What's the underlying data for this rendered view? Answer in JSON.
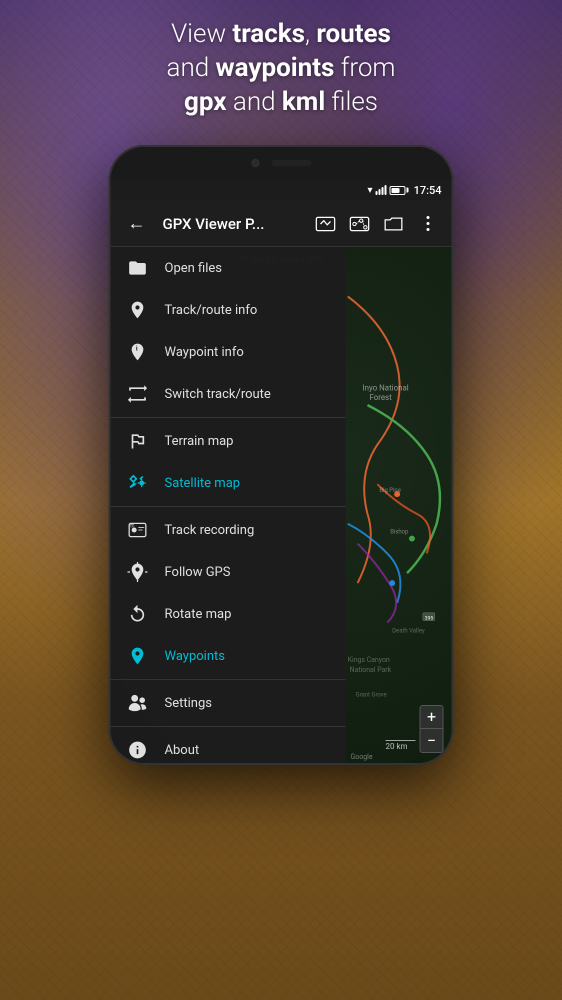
{
  "tagline": {
    "line1": "View ",
    "bold1": "tracks",
    "line2": ", ",
    "bold2": "routes",
    "line3": " and ",
    "bold3": "waypoints",
    "line4": " from ",
    "bold4": "gpx",
    "line5": " and ",
    "bold5": "kml",
    "line6": " files"
  },
  "status_bar": {
    "time": "17:54"
  },
  "toolbar": {
    "title": "GPX Viewer P...",
    "back_label": "←"
  },
  "map": {
    "subtitle": "All tracks/routes (20)"
  },
  "menu": {
    "items": [
      {
        "id": "open-files",
        "label": "Open files",
        "active": false,
        "divider_after": false
      },
      {
        "id": "track-route-info",
        "label": "Track/route info",
        "active": false,
        "divider_after": false
      },
      {
        "id": "waypoint-info",
        "label": "Waypoint info",
        "active": false,
        "divider_after": false
      },
      {
        "id": "switch-track-route",
        "label": "Switch track/route",
        "active": false,
        "divider_after": true
      },
      {
        "id": "terrain-map",
        "label": "Terrain map",
        "active": false,
        "divider_after": false
      },
      {
        "id": "satellite-map",
        "label": "Satellite map",
        "active": true,
        "divider_after": true
      },
      {
        "id": "track-recording",
        "label": "Track recording",
        "active": false,
        "divider_after": false
      },
      {
        "id": "follow-gps",
        "label": "Follow GPS",
        "active": false,
        "divider_after": false
      },
      {
        "id": "rotate-map",
        "label": "Rotate map",
        "active": false,
        "divider_after": false
      },
      {
        "id": "waypoints",
        "label": "Waypoints",
        "active": true,
        "divider_after": true
      },
      {
        "id": "settings",
        "label": "Settings",
        "active": false,
        "divider_after": false
      },
      {
        "id": "about",
        "label": "About",
        "active": false,
        "divider_after": false
      }
    ]
  },
  "zoom": {
    "plus": "+",
    "minus": "−"
  },
  "map_labels": {
    "scale": "20 km",
    "google": "Google"
  }
}
